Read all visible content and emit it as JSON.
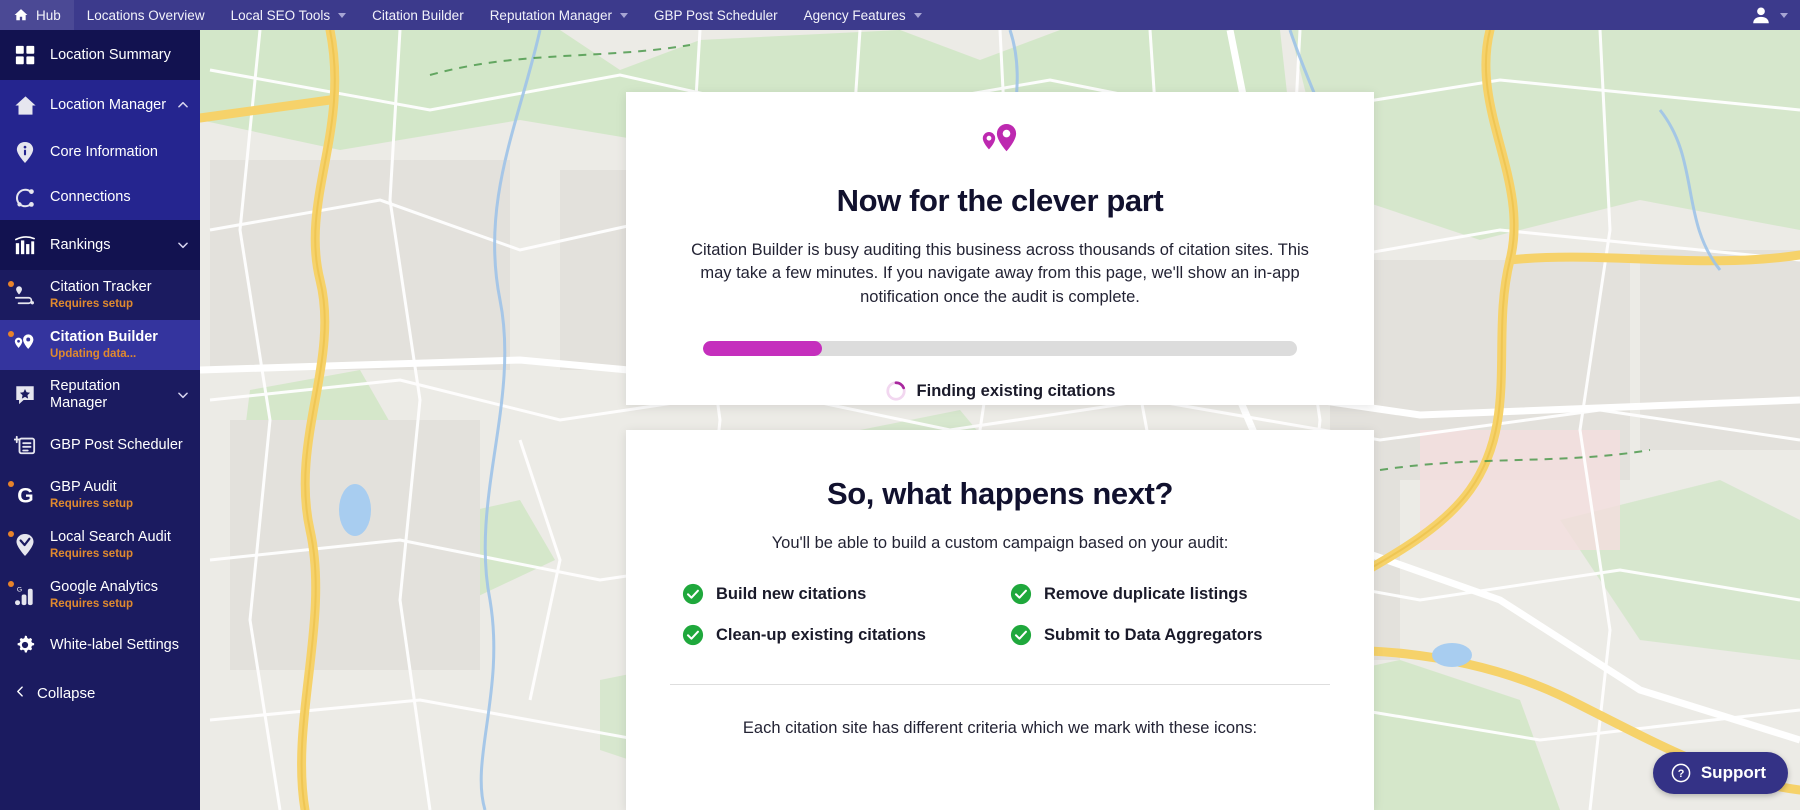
{
  "topnav": {
    "home_label": "Hub",
    "items": [
      {
        "label": "Locations Overview",
        "has_caret": false
      },
      {
        "label": "Local SEO Tools",
        "has_caret": true
      },
      {
        "label": "Citation Builder",
        "has_caret": false
      },
      {
        "label": "Reputation Manager",
        "has_caret": true
      },
      {
        "label": "GBP Post Scheduler",
        "has_caret": false
      },
      {
        "label": "Agency Features",
        "has_caret": true
      }
    ],
    "account_icon": "user-avatar-icon",
    "account_caret": "chevron-down-icon",
    "bar_color": "#3c3a8c"
  },
  "sidebar": {
    "bg_color": "#1b1b60",
    "active_color": "#34349e",
    "badge_color": "#e8832a",
    "items": [
      {
        "label": "Location Summary",
        "sub": "",
        "icon": "grid-icon",
        "badge": false,
        "chevron": ""
      },
      {
        "label": "Location Manager",
        "sub": "",
        "icon": "home-icon",
        "badge": false,
        "chevron": "chevron-up-icon"
      },
      {
        "label": "Core Information",
        "sub": "",
        "icon": "info-pin-icon",
        "badge": false,
        "chevron": ""
      },
      {
        "label": "Connections",
        "sub": "",
        "icon": "connections-icon",
        "badge": false,
        "chevron": ""
      },
      {
        "label": "Rankings",
        "sub": "",
        "icon": "bar-chart-icon",
        "badge": false,
        "chevron": "chevron-down-icon"
      },
      {
        "label": "Citation Tracker",
        "sub": "Requires setup",
        "icon": "citation-tracker-icon",
        "badge": true,
        "chevron": ""
      },
      {
        "label": "Citation Builder",
        "sub": "Updating data...",
        "icon": "map-pins-icon",
        "badge": true,
        "chevron": ""
      },
      {
        "label": "Reputation Manager",
        "sub": "",
        "icon": "star-chat-icon",
        "badge": false,
        "chevron": "chevron-down-icon"
      },
      {
        "label": "GBP Post Scheduler",
        "sub": "",
        "icon": "add-post-icon",
        "badge": false,
        "chevron": ""
      },
      {
        "label": "GBP Audit",
        "sub": "Requires setup",
        "icon": "google-g-icon",
        "badge": true,
        "chevron": ""
      },
      {
        "label": "Local Search Audit",
        "sub": "Requires setup",
        "icon": "pin-check-icon",
        "badge": true,
        "chevron": ""
      },
      {
        "label": "Google Analytics",
        "sub": "Requires setup",
        "icon": "analytics-icon",
        "badge": true,
        "chevron": ""
      },
      {
        "label": "White-label Settings",
        "sub": "",
        "icon": "gear-icon",
        "badge": false,
        "chevron": ""
      }
    ],
    "collapse_label": "Collapse",
    "collapse_icon": "chevron-left-icon"
  },
  "progress_card": {
    "icon": "map-pins-icon",
    "title": "Now for the clever part",
    "body": "Citation Builder is busy auditing this business across thousands of citation sites. This may take a few minutes. If you navigate away from this page, we'll show an in-app notification once the audit is complete.",
    "progress_percent": 20,
    "progress_fill_color": "#c52fbd",
    "progress_track_color": "#dcdcdc",
    "status_icon": "loading-spinner-icon",
    "status_text": "Finding existing citations"
  },
  "next_card": {
    "title": "So, what happens next?",
    "subtitle": "You'll be able to build a custom campaign based on your audit:",
    "check_color": "#1fa83c",
    "bullets": [
      {
        "label": "Build new citations",
        "icon": "check-circle-icon"
      },
      {
        "label": "Remove duplicate listings",
        "icon": "check-circle-icon"
      },
      {
        "label": "Clean-up existing citations",
        "icon": "check-circle-icon"
      },
      {
        "label": "Submit to Data Aggregators",
        "icon": "check-circle-icon"
      }
    ],
    "footnote": "Each citation site has different criteria which we mark with these icons:"
  },
  "support": {
    "label": "Support",
    "icon": "question-circle-icon",
    "bg_color": "#343286"
  }
}
